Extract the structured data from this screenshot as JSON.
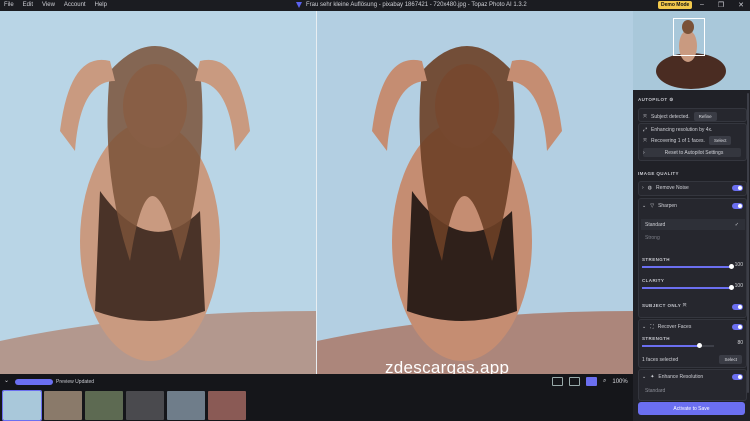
{
  "menu": [
    "File",
    "Edit",
    "View",
    "Account",
    "Help"
  ],
  "window_title": "Frau sehr kleine Auflösung - pixabay 1867421 - 720x480.jpg - Topaz Photo AI 1.3.2",
  "demo_mode": "Demo Mode",
  "watermark": "zdescargas.app",
  "bottom": {
    "preview_label": "Preview Updated",
    "zoom": "100%",
    "thumb_count": 6
  },
  "panel": {
    "autopilot_label": "AUTOPILOT",
    "subject_text": "Subject detected.",
    "refine_label": "Refine",
    "enhancing_text": "Enhancing resolution by 4x.",
    "recovering_text": "Recovering 1 of 1 faces.",
    "select_label": "Select",
    "reset_label": "Reset to Autopilot Settings",
    "image_quality_label": "IMAGE QUALITY",
    "remove_noise_label": "Remove Noise",
    "sharpen_label": "Sharpen",
    "sharpen_mode_standard": "Standard",
    "sharpen_mode_strong": "Strong",
    "strength_label": "STRENGTH",
    "strength_value": "100",
    "clarity_label": "CLARITY",
    "clarity_value": "100",
    "subject_only_label": "SUBJECT ONLY",
    "recover_faces_label": "Recover Faces",
    "rf_strength_label": "STRENGTH",
    "rf_strength_value": "80",
    "faces_selected": "1 faces selected",
    "rf_select_label": "Select",
    "enhance_resolution_label": "Enhance Resolution",
    "er_mode": "Standard",
    "activate_label": "Activate to Save"
  },
  "colors": {
    "accent": "#6b6ff0",
    "demo": "#f2c94c"
  },
  "sliders": {
    "sharpen_strength": 1.0,
    "sharpen_clarity": 1.0,
    "recover_faces_strength": 0.8
  }
}
